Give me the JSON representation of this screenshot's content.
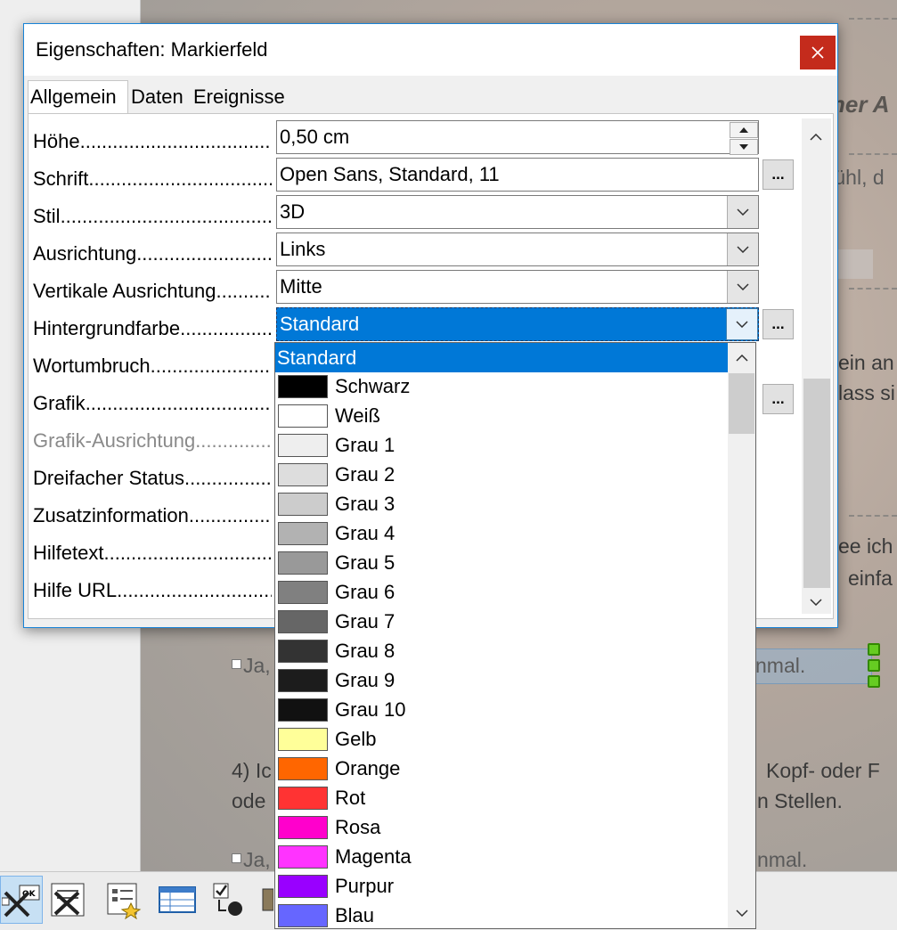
{
  "dialog": {
    "title": "Eigenschaften: Markierfeld",
    "tabs": [
      "Allgemein",
      "Daten",
      "Ereignisse"
    ],
    "properties": [
      {
        "label": "Höhe",
        "value": "0,50 cm",
        "control": "spin"
      },
      {
        "label": "Schrift",
        "value": "Open Sans, Standard, 11",
        "control": "ellipsis"
      },
      {
        "label": "Stil",
        "value": "3D",
        "control": "dropdown"
      },
      {
        "label": "Ausrichtung",
        "value": "Links",
        "control": "dropdown"
      },
      {
        "label": "Vertikale Ausrichtung",
        "value": "Mitte",
        "control": "dropdown"
      },
      {
        "label": "Hintergrundfarbe",
        "value": "Standard",
        "control": "dropdown-open"
      },
      {
        "label": "Wortumbruch",
        "value": "",
        "control": "hidden"
      },
      {
        "label": "Grafik",
        "value": "",
        "control": "ellipsis"
      },
      {
        "label": "Grafik-Ausrichtung",
        "value": "",
        "control": "disabled"
      },
      {
        "label": "Dreifacher Status",
        "value": "",
        "control": "hidden"
      },
      {
        "label": "Zusatzinformation",
        "value": "",
        "control": "hidden"
      },
      {
        "label": "Hilfetext",
        "value": "",
        "control": "hidden"
      },
      {
        "label": "Hilfe URL",
        "value": "",
        "control": "hidden"
      }
    ],
    "ellipsis_label": "...",
    "dots": "................................................................................"
  },
  "dropdown": {
    "selected": "Standard",
    "items": [
      {
        "label": "Schwarz",
        "color": "#000000"
      },
      {
        "label": "Weiß",
        "color": "#ffffff"
      },
      {
        "label": "Grau 1",
        "color": "#eeeeee"
      },
      {
        "label": "Grau 2",
        "color": "#dddddd"
      },
      {
        "label": "Grau 3",
        "color": "#cccccc"
      },
      {
        "label": "Grau 4",
        "color": "#b2b2b2"
      },
      {
        "label": "Grau 5",
        "color": "#999999"
      },
      {
        "label": "Grau 6",
        "color": "#808080"
      },
      {
        "label": "Grau 7",
        "color": "#666666"
      },
      {
        "label": "Grau 8",
        "color": "#333333"
      },
      {
        "label": "Grau 9",
        "color": "#1c1c1c"
      },
      {
        "label": "Grau 10",
        "color": "#111111"
      },
      {
        "label": "Gelb",
        "color": "#ffff99"
      },
      {
        "label": "Orange",
        "color": "#ff6600"
      },
      {
        "label": "Rot",
        "color": "#ff3333"
      },
      {
        "label": "Rosa",
        "color": "#ff00cc"
      },
      {
        "label": "Magenta",
        "color": "#ff33ff"
      },
      {
        "label": "Purpur",
        "color": "#9900ff"
      },
      {
        "label": "Blau",
        "color": "#6666ff"
      }
    ]
  },
  "background_doc": {
    "heading_fragment": "ner A",
    "texts": [
      "fühl, d",
      "ein an",
      "lass si",
      "ee ich",
      "einfa",
      "nmal.",
      "4) Ic",
      "Kopf- oder F",
      "ode",
      "n Stellen.",
      "Ja,",
      "Ja,",
      "nmal."
    ]
  },
  "colors": {
    "accent": "#0078d7",
    "close": "#c42b1c",
    "handle": "#66cc22"
  }
}
